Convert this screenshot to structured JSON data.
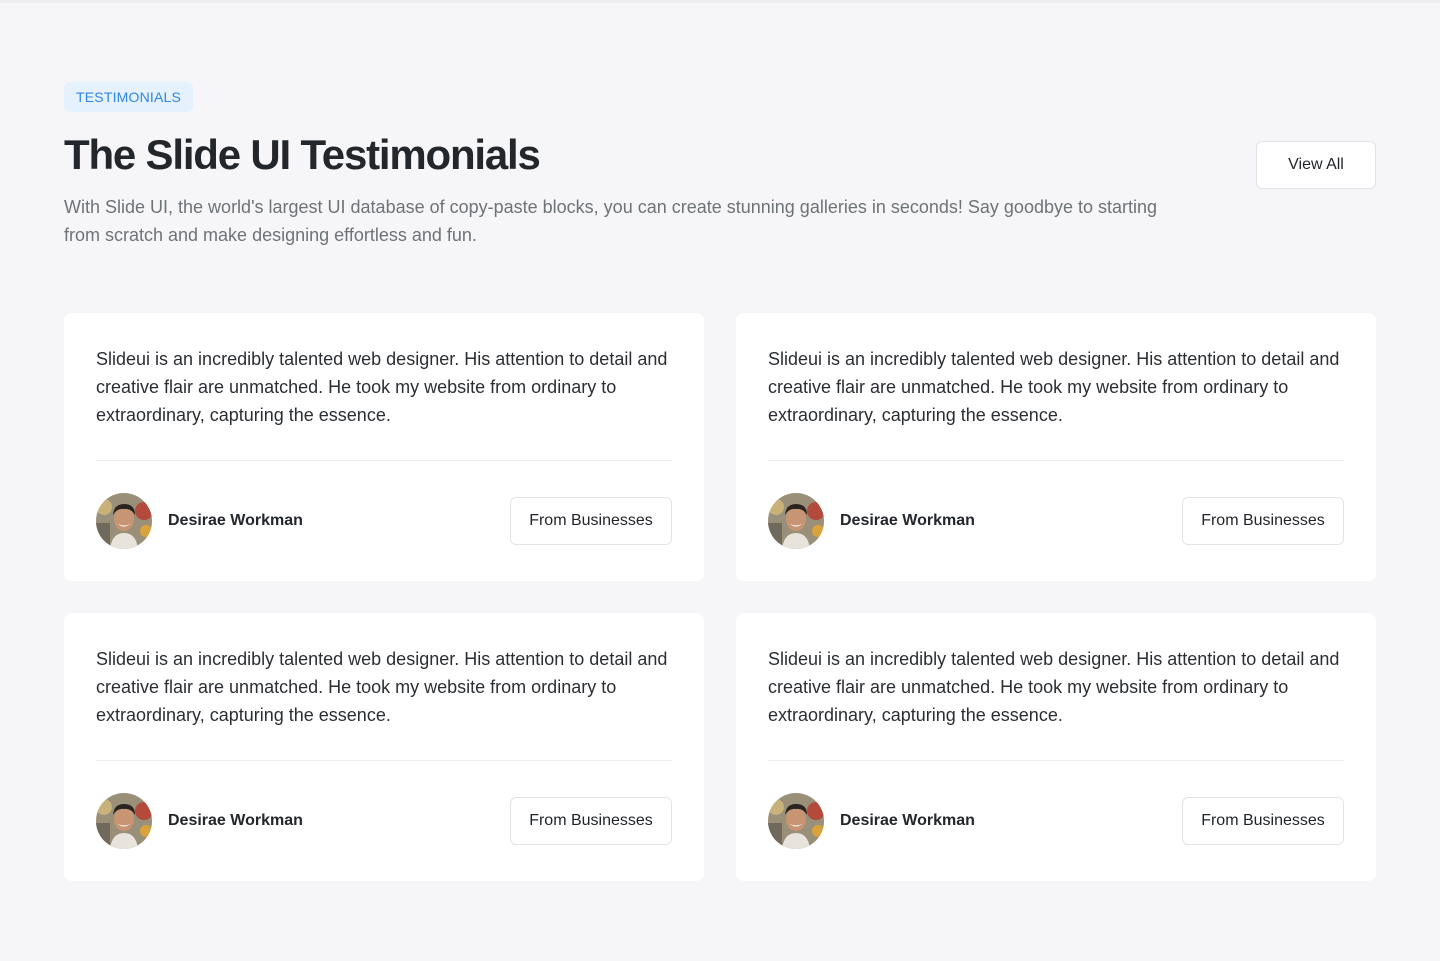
{
  "header": {
    "badge": "TESTIMONIALS",
    "title": "The Slide UI Testimonials",
    "subtitle": "With Slide UI, the world's largest UI database of copy-paste blocks, you can create stunning galleries in seconds! Say goodbye to starting from scratch and make designing effortless and fun.",
    "view_all_label": "View All"
  },
  "testimonials": [
    {
      "quote": "Slideui is an incredibly talented web designer. His attention to detail and creative flair are unmatched. He took my website from ordinary to extraordinary, capturing the essence.",
      "author": "Desirae Workman",
      "source_label": "From Businesses"
    },
    {
      "quote": "Slideui is an incredibly talented web designer. His attention to detail and creative flair are unmatched. He took my website from ordinary to extraordinary, capturing the essence.",
      "author": "Desirae Workman",
      "source_label": "From Businesses"
    },
    {
      "quote": "Slideui is an incredibly talented web designer. His attention to detail and creative flair are unmatched. He took my website from ordinary to extraordinary, capturing the essence.",
      "author": "Desirae Workman",
      "source_label": "From Businesses"
    },
    {
      "quote": "Slideui is an incredibly talented web designer. His attention to detail and creative flair are unmatched. He took my website from ordinary to extraordinary, capturing the essence.",
      "author": "Desirae Workman",
      "source_label": "From Businesses"
    }
  ],
  "colors": {
    "page_background": "#f6f6f8",
    "badge_background": "#e5f1fd",
    "badge_text": "#2f86e6",
    "card_background": "#ffffff"
  }
}
